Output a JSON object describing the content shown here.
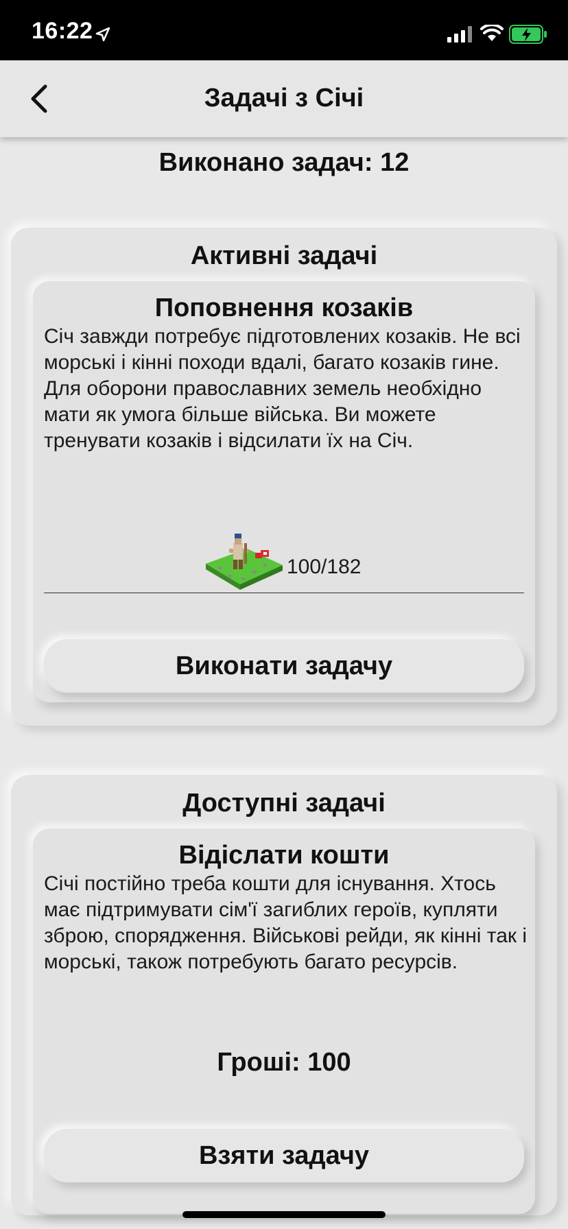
{
  "status_bar": {
    "time": "16:22"
  },
  "nav": {
    "title": "Задачі з Січі"
  },
  "summary": {
    "completed": "Виконано задач: 12"
  },
  "active_section": {
    "title": "Активні задачі",
    "task": {
      "title": "Поповнення козаків",
      "description": "Січ завжди потребує підготовлених козаків. Не всі морські і кінні походи вдалі, багато козаків гине. Для оборони православних земель необхідно мати як умога більше війська. Ви можете тренувати козаків і відсилати їх на Січ.",
      "progress_text": "100/182",
      "progress_current": 100,
      "progress_total": 182,
      "button_label": "Виконати задачу"
    }
  },
  "available_section": {
    "title": "Доступні задачі",
    "task": {
      "title": "Відіслати кошти",
      "description": "Січі постійно треба кошти для існування. Хтось має підтримувати сім'ї загиблих героїв, купляти зброю, спорядження. Військові рейди, як кінні так і морські, також потребують багато ресурсів.",
      "reward": "Гроші: 100",
      "button_label": "Взяти задачу"
    }
  },
  "colors": {
    "background": "#e8e8e8",
    "status_bar": "#000000",
    "battery_fill": "#34c759"
  }
}
